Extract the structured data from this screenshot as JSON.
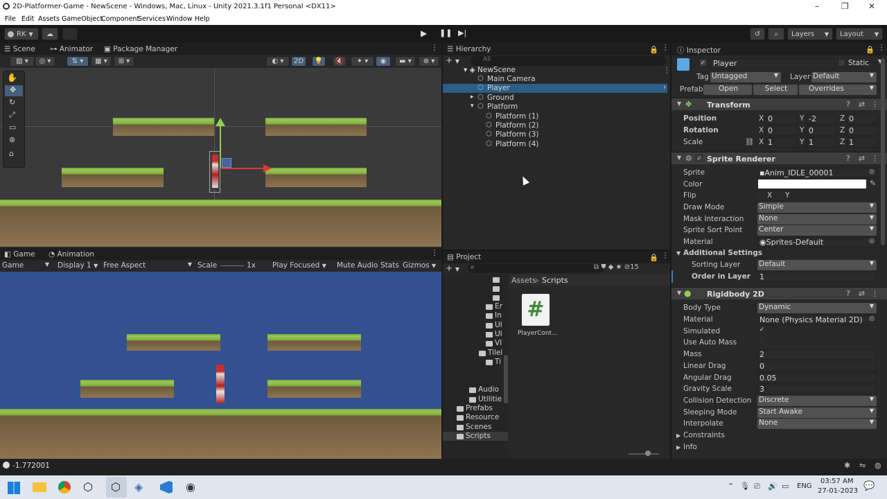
{
  "window": {
    "title": "2D-Platformer-Game - NewScene - Windows, Mac, Linux - Unity 2021.3.1f1 Personal <DX11>",
    "minimize": "–",
    "maximize": "❐",
    "close": "✕"
  },
  "menu": [
    "File",
    "Edit",
    "Assets",
    "GameObject",
    "Component",
    "Services",
    "Window",
    "Help"
  ],
  "toolbar": {
    "account": "RK",
    "layers": "Layers",
    "layout": "Layout"
  },
  "scene_tabs": {
    "scene": "Scene",
    "animator": "Animator",
    "package_manager": "Package Manager",
    "mode2d": "2D"
  },
  "game_tabs": {
    "game": "Game",
    "animation": "Animation"
  },
  "game_bar": {
    "view": "Game",
    "display": "Display 1",
    "aspect": "Free Aspect",
    "scale_label": "Scale",
    "scale_value": "1x",
    "play_focused": "Play Focused",
    "mute": "Mute Audio",
    "stats": "Stats",
    "gizmos": "Gizmos"
  },
  "hierarchy": {
    "title": "Hierarchy",
    "search_placeholder": "All",
    "scene": "NewScene",
    "items": [
      {
        "label": "Main Camera",
        "depth": 1
      },
      {
        "label": "Player",
        "depth": 1,
        "selected": true
      },
      {
        "label": "Ground",
        "depth": 1
      },
      {
        "label": "Platform",
        "depth": 1
      },
      {
        "label": "Platform (1)",
        "depth": 2
      },
      {
        "label": "Platform (2)",
        "depth": 2
      },
      {
        "label": "Platform (3)",
        "depth": 2
      },
      {
        "label": "Platform (4)",
        "depth": 2
      }
    ]
  },
  "project": {
    "title": "Project",
    "count": "15",
    "breadcrumb": [
      "Assets",
      "Scripts"
    ],
    "tree": [
      "Er",
      "In",
      "UI",
      "UI",
      "VI",
      "Tilel",
      "Ti",
      "Audio",
      "Utilitie",
      "Prefabs",
      "Resource",
      "Scenes",
      "Scripts"
    ],
    "asset": {
      "name": "PlayerCont...",
      "glyph": "#"
    }
  },
  "inspector": {
    "title": "Inspector",
    "object_name": "Player",
    "static": "Static",
    "tag_label": "Tag",
    "tag": "Untagged",
    "layer_label": "Layer",
    "layer": "Default",
    "prefab_label": "Prefab",
    "open": "Open",
    "select": "Select",
    "overrides": "Overrides",
    "transform": {
      "title": "Transform",
      "position": {
        "label": "Position",
        "x": "0",
        "y": "-2",
        "z": "0"
      },
      "rotation": {
        "label": "Rotation",
        "x": "0",
        "y": "0",
        "z": "0"
      },
      "scale": {
        "label": "Scale",
        "x": "1",
        "y": "1",
        "z": "1"
      }
    },
    "sprite_renderer": {
      "title": "Sprite Renderer",
      "sprite_label": "Sprite",
      "sprite": "Anim_IDLE_00001",
      "color_label": "Color",
      "color": "#ffffff",
      "flip_label": "Flip",
      "flip_x": "X",
      "flip_y": "Y",
      "draw_mode_label": "Draw Mode",
      "draw_mode": "Simple",
      "mask_label": "Mask Interaction",
      "mask": "None",
      "sort_point_label": "Sprite Sort Point",
      "sort_point": "Center",
      "material_label": "Material",
      "material": "Sprites-Default",
      "additional": "Additional Settings",
      "sorting_layer_label": "Sorting Layer",
      "sorting_layer": "Default",
      "order_label": "Order in Layer",
      "order": "1"
    },
    "rigidbody": {
      "title": "Rigidbody 2D",
      "body_type_label": "Body Type",
      "body_type": "Dynamic",
      "material_label": "Material",
      "material": "None (Physics Material 2D)",
      "simulated_label": "Simulated",
      "auto_mass_label": "Use Auto Mass",
      "mass_label": "Mass",
      "mass": "2",
      "linear_drag_label": "Linear Drag",
      "linear_drag": "0",
      "angular_drag_label": "Angular Drag",
      "angular_drag": "0.05",
      "gravity_label": "Gravity Scale",
      "gravity": "3",
      "collision_label": "Collision Detection",
      "collision": "Discrete",
      "sleeping_label": "Sleeping Mode",
      "sleeping": "Start Awake",
      "interpolate_label": "Interpolate",
      "interpolate": "None",
      "constraints": "Constraints",
      "info": "Info"
    }
  },
  "status": {
    "message": "-1.772001"
  },
  "taskbar": {
    "lang": "ENG",
    "time": "03:57 AM",
    "date": "27-01-2023"
  }
}
